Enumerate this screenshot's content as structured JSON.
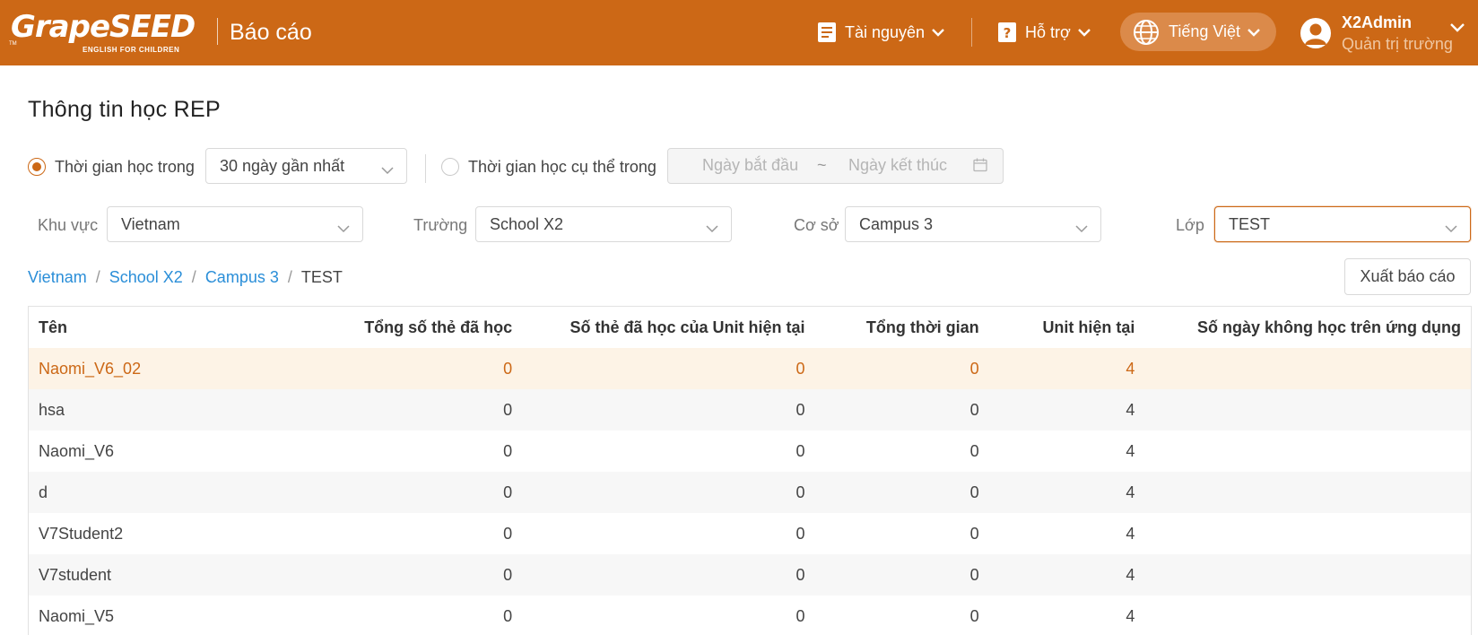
{
  "header": {
    "logo_text": "GrapeSEED",
    "logo_sub": "ENGLISH FOR CHILDREN",
    "logo_tm": "TM",
    "app_title": "Báo cáo",
    "resources_label": "Tài nguyên",
    "support_label": "Hỗ trợ",
    "language_label": "Tiếng Việt",
    "user_name": "X2Admin",
    "user_role": "Quản trị trường",
    "bg_color": "#cc6816"
  },
  "page": {
    "title": "Thông tin học REP"
  },
  "filters": {
    "time_in_label": "Thời gian học trong",
    "time_in_value": "30 ngày gần nhất",
    "specific_time_label": "Thời gian học cụ thể trong",
    "start_date_placeholder": "Ngày bắt đầu",
    "date_separator": "~",
    "end_date_placeholder": "Ngày kết thúc",
    "region_label": "Khu vực",
    "region_value": "Vietnam",
    "school_label": "Trường",
    "school_value": "School X2",
    "campus_label": "Cơ sở",
    "campus_value": "Campus 3",
    "class_label": "Lớp",
    "class_value": "TEST"
  },
  "breadcrumb": {
    "items": [
      "Vietnam",
      "School X2",
      "Campus 3"
    ],
    "separator": "/",
    "current": "TEST"
  },
  "export_label": "Xuất báo cáo",
  "table": {
    "headers": [
      "Tên",
      "Tổng số thẻ đã học",
      "Số thẻ đã học của Unit hiện tại",
      "Tổng thời gian",
      "Unit hiện tại",
      "Số ngày không học trên ứng dụng"
    ],
    "rows": [
      [
        "Naomi_V6_02",
        "0",
        "0",
        "0",
        "4",
        ""
      ],
      [
        "hsa",
        "0",
        "0",
        "0",
        "4",
        ""
      ],
      [
        "Naomi_V6",
        "0",
        "0",
        "0",
        "4",
        ""
      ],
      [
        "d",
        "0",
        "0",
        "0",
        "4",
        ""
      ],
      [
        "V7Student2",
        "0",
        "0",
        "0",
        "4",
        ""
      ],
      [
        "V7student",
        "0",
        "0",
        "0",
        "4",
        ""
      ],
      [
        "Naomi_V5",
        "0",
        "0",
        "0",
        "4",
        ""
      ]
    ]
  },
  "colors": {
    "accent": "#cc6816",
    "link": "#2a8ed8",
    "highlight_row": "#fdf3e6"
  }
}
